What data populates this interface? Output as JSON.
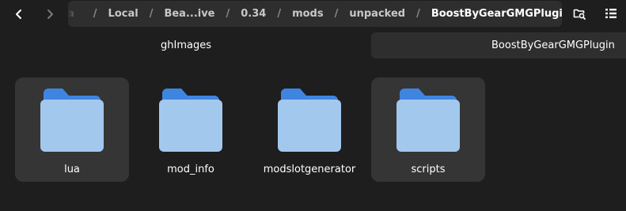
{
  "navigation": {
    "back_icon": "chevron-left-icon",
    "forward_icon": "chevron-right-icon"
  },
  "pathbar": {
    "crumbs": [
      "a",
      "Local",
      "Bea...ive",
      "0.34",
      "mods",
      "unpacked",
      "BoostByGearGMGPlugin"
    ],
    "separator": "/",
    "menu_icon": "vertical-dots-icon"
  },
  "toolbar": {
    "search_icon": "folder-search-icon",
    "view_icon": "list-view-icon"
  },
  "tabs": [
    {
      "label": "ghImages",
      "active": false
    },
    {
      "label": "BoostByGearGMGPlugin",
      "active": true
    }
  ],
  "files": [
    {
      "name": "lua",
      "selected": true
    },
    {
      "name": "mod_info",
      "selected": false
    },
    {
      "name": "modslotgenerator",
      "selected": false
    },
    {
      "name": "scripts",
      "selected": true
    }
  ],
  "colors": {
    "background": "#1e1e1e",
    "pathbar": "#2e2e2e",
    "selection": "#353535",
    "folder_back": "#3f85e0",
    "folder_front": "#a3c8ee"
  }
}
